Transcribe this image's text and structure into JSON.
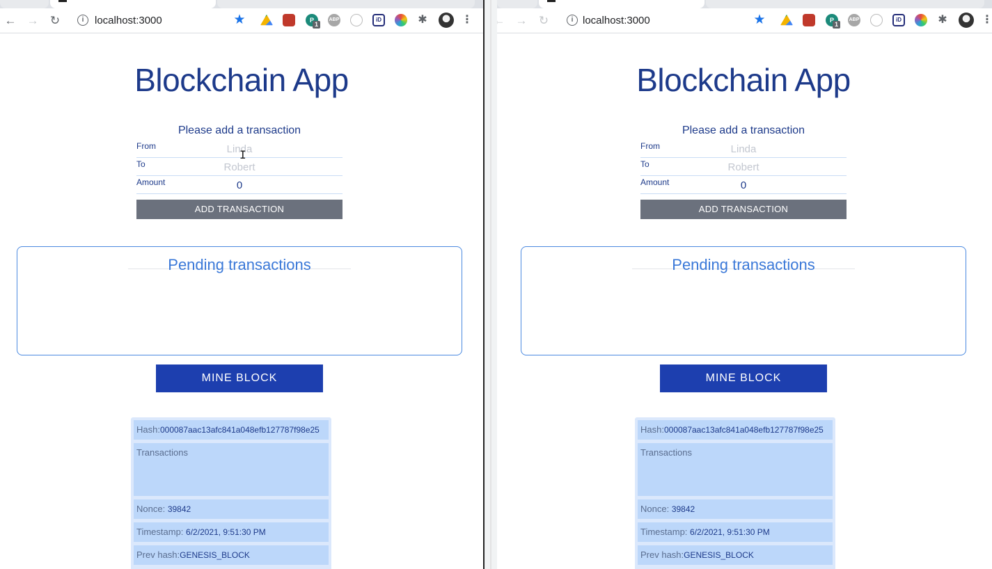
{
  "browser": {
    "url": "localhost:3000",
    "nav": {
      "back": "←",
      "forward": "→",
      "reload": "↻",
      "info": "i"
    },
    "extensions": [
      {
        "name": "bookmark-star-icon",
        "glyph": "★",
        "cls": "star"
      },
      {
        "name": "google-drive-icon",
        "glyph": "",
        "cls": "drive"
      },
      {
        "name": "red-extension-icon",
        "glyph": "",
        "cls": "red"
      },
      {
        "name": "green-extension-icon",
        "glyph": "P",
        "cls": "green",
        "badge": "1"
      },
      {
        "name": "adblock-icon",
        "glyph": "ABP",
        "cls": "gray"
      },
      {
        "name": "circle-extension-icon",
        "glyph": "",
        "cls": "white"
      },
      {
        "name": "id-extension-icon",
        "glyph": "iD",
        "cls": "id"
      },
      {
        "name": "color-wheel-icon",
        "glyph": "",
        "cls": "color"
      },
      {
        "name": "puzzle-icon",
        "glyph": "✱",
        "cls": "puzzle"
      },
      {
        "name": "avatar-icon",
        "glyph": "",
        "cls": "avatar"
      },
      {
        "name": "kebab-menu-icon",
        "glyph": "⋮",
        "cls": "menu"
      }
    ]
  },
  "app": {
    "title": "Blockchain App",
    "form": {
      "heading": "Please add a transaction",
      "from_label": "From",
      "from_placeholder": "Linda",
      "to_label": "To",
      "to_placeholder": "Robert",
      "amount_label": "Amount",
      "amount_value": "0",
      "add_button": "ADD TRANSACTION"
    },
    "pending": {
      "title": "Pending transactions"
    },
    "mine_button": "MINE BLOCK",
    "block": {
      "hash_label": "Hash:",
      "hash_value": "000087aac13afc841a048efb127787f98e25",
      "transactions_label": "Transactions",
      "nonce_label": "Nonce:",
      "nonce_value": "39842",
      "timestamp_label": "Timestamp:",
      "timestamp_value": "6/2/2021, 9:51:30 PM",
      "prev_hash_label": "Prev hash:",
      "prev_hash_value": "GENESIS_BLOCK"
    }
  },
  "cursor": "I"
}
